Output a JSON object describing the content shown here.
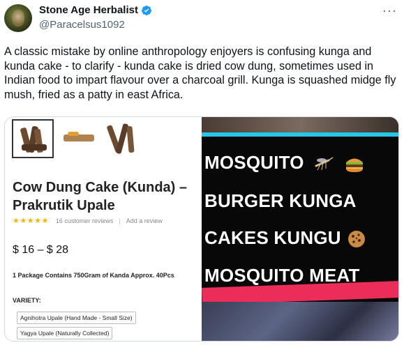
{
  "author": {
    "display_name": "Stone Age Herbalist",
    "handle": "@Paracelsus1092"
  },
  "tweet": {
    "text": "A classic mistake by online anthropology enjoyers is confusing kunga and kunda cake - to clarify - kunda cake is dried cow dung, sometimes used in Indian food to impart flavour over a charcoal grill. Kunga is squashed midge fly mush, fried as a patty in east Africa."
  },
  "product": {
    "title": "Cow Dung Cake (Kunda) – Prakrutik Upale",
    "rating_stars": 5,
    "reviews": "16 customer reviews",
    "add_review": "Add a review",
    "price": "$ 16 – $ 28",
    "package": "1 Package Contains 750Gram of Kanda Approx. 40Pcs",
    "variety_label": "VARIETY:",
    "variety_options": [
      "Agnihotra Upale (Hand Made - Small Size)",
      "Yagya Upale (Naturally Collected)"
    ]
  },
  "overlay": {
    "lines": [
      "MOSQUITO",
      "BURGER KUNGA",
      "CAKES KUNGU",
      "MOSQUITO MEAT"
    ]
  },
  "colors": {
    "verified": "#1d9bf0",
    "star": "#f2b600",
    "cyan": "#25c6e6",
    "pink": "#ec2d5a"
  }
}
